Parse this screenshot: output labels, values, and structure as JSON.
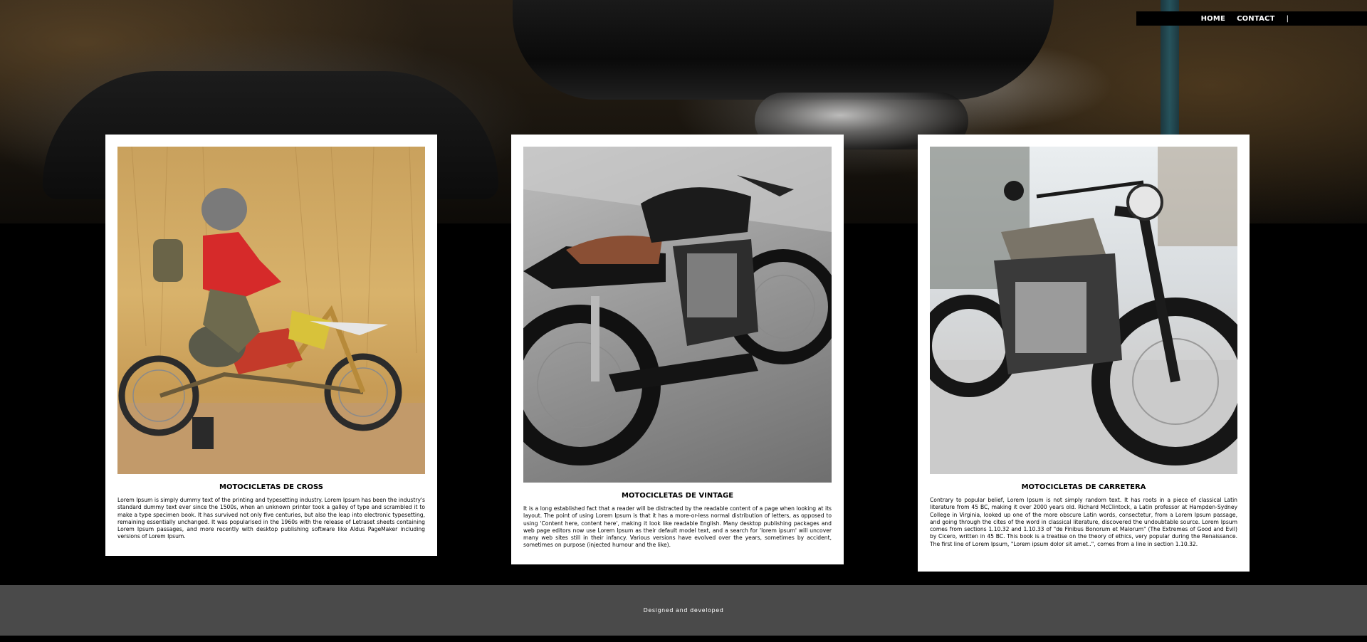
{
  "nav": {
    "items": [
      {
        "label": "HOME"
      },
      {
        "label": "CONTACT"
      }
    ],
    "separator": "|"
  },
  "cards": [
    {
      "title": "MOTOCICLETAS DE CROSS",
      "image": "dirt-bike-rider-photo",
      "text": "Lorem Ipsum is simply dummy text of the printing and typesetting industry. Lorem Ipsum has been the industry's standard dummy text ever since the 1500s, when an unknown printer took a galley of type and scrambled it to make a type specimen book. It has survived not only five centuries, but also the leap into electronic typesetting, remaining essentially unchanged. It was popularised in the 1960s with the release of Letraset sheets containing Lorem Ipsum passages, and more recently with desktop publishing software like Aldus PageMaker including versions of Lorem Ipsum."
    },
    {
      "title": "MOTOCICLETAS DE VINTAGE",
      "image": "vintage-cafe-racer-photo",
      "text": "It is a long established fact that a reader will be distracted by the readable content of a page when looking at its layout. The point of using Lorem Ipsum is that it has a more-or-less normal distribution of letters, as opposed to using 'Content here, content here', making it look like readable English. Many desktop publishing packages and web page editors now use Lorem Ipsum as their default model text, and a search for 'lorem ipsum' will uncover many web sites still in their infancy. Various versions have evolved over the years, sometimes by accident, sometimes on purpose (injected humour and the like)."
    },
    {
      "title": "MOTOCICLETAS DE CARRETERA",
      "image": "road-motorcycle-photo",
      "text": "Contrary to popular belief, Lorem Ipsum is not simply random text. It has roots in a piece of classical Latin literature from 45 BC, making it over 2000 years old. Richard McClintock, a Latin professor at Hampden-Sydney College in Virginia, looked up one of the more obscure Latin words, consectetur, from a Lorem Ipsum passage, and going through the cites of the word in classical literature, discovered the undoubtable source. Lorem Ipsum comes from sections 1.10.32 and 1.10.33 of \"de Finibus Bonorum et Malorum\" (The Extremes of Good and Evil) by Cicero, written in 45 BC. This book is a treatise on the theory of ethics, very popular during the Renaissance. The first line of Lorem Ipsum, \"Lorem ipsum dolor sit amet..\", comes from a line in section 1.10.32."
    }
  ],
  "footer": {
    "text": "Designed and developed"
  }
}
